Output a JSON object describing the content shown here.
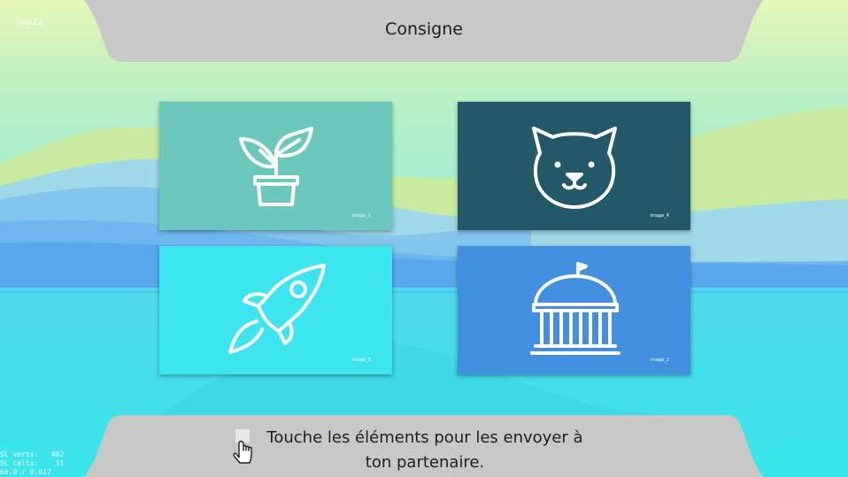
{
  "app": {
    "game_id": "jeu22"
  },
  "header": {
    "title": "Consigne"
  },
  "cards": [
    {
      "tag": "image_1",
      "icon": "plant-icon",
      "color": "#6cc8bd"
    },
    {
      "tag": "image_4",
      "icon": "cat-icon",
      "color": "#235868"
    },
    {
      "tag": "image_3",
      "icon": "rocket-icon",
      "color": "#3ce6ee"
    },
    {
      "tag": "image_2",
      "icon": "capitol-icon",
      "color": "#438fe0"
    }
  ],
  "footer": {
    "line1": "Touche les éléments pour les envoyer à",
    "line2": "ton partenaire."
  },
  "debug": {
    "line1": "SL verts:   402",
    "line2": "SL calls:    11",
    "line3": "60.0 / 0.017"
  }
}
